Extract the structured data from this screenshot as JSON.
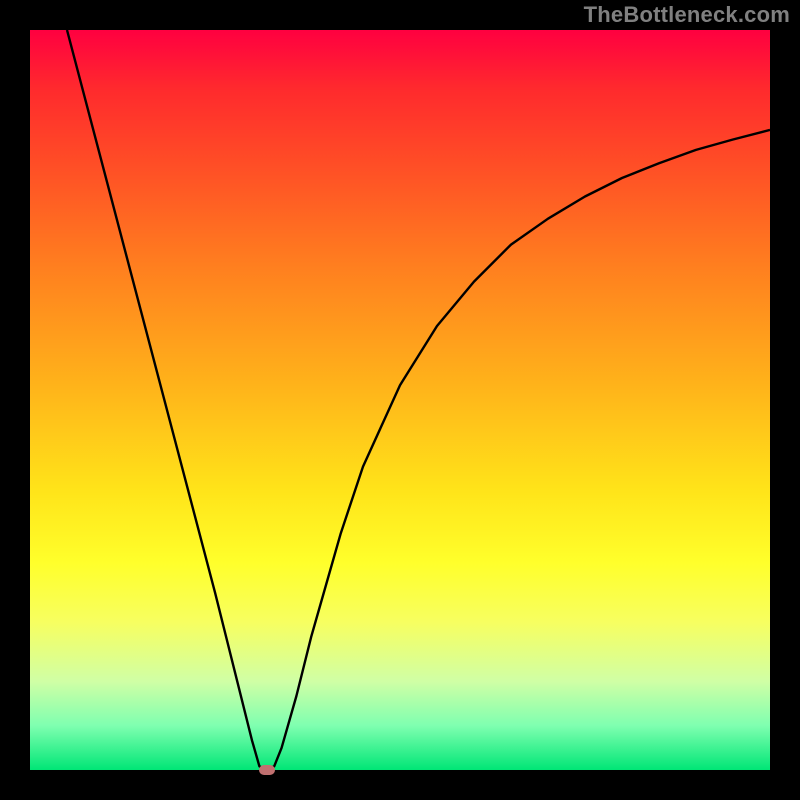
{
  "watermark": "TheBottleneck.com",
  "chart_data": {
    "type": "line",
    "title": "",
    "xlabel": "",
    "ylabel": "",
    "xlim": [
      0,
      100
    ],
    "ylim": [
      0,
      100
    ],
    "grid": false,
    "legend": false,
    "series": [
      {
        "name": "curve",
        "x": [
          5,
          10,
          15,
          20,
          25,
          28,
          30,
          31,
          32,
          33,
          34,
          36,
          38,
          40,
          42,
          45,
          50,
          55,
          60,
          65,
          70,
          75,
          80,
          85,
          90,
          95,
          100
        ],
        "y": [
          100,
          81,
          62,
          43,
          24,
          12,
          4,
          0.5,
          0,
          0.5,
          3,
          10,
          18,
          25,
          32,
          41,
          52,
          60,
          66,
          71,
          74.5,
          77.5,
          80,
          82,
          83.8,
          85.2,
          86.5
        ]
      }
    ],
    "marker": {
      "x": 32,
      "y": 0,
      "shape": "pill",
      "color": "#c07070"
    },
    "background_gradient": {
      "stops": [
        {
          "pos": 0,
          "color": "#ff0040"
        },
        {
          "pos": 8,
          "color": "#ff2a2d"
        },
        {
          "pos": 18,
          "color": "#ff4d26"
        },
        {
          "pos": 32,
          "color": "#ff7f1f"
        },
        {
          "pos": 48,
          "color": "#ffb31a"
        },
        {
          "pos": 62,
          "color": "#ffe319"
        },
        {
          "pos": 72,
          "color": "#ffff2b"
        },
        {
          "pos": 80,
          "color": "#f7ff60"
        },
        {
          "pos": 88,
          "color": "#d0ffa5"
        },
        {
          "pos": 94,
          "color": "#7fffb0"
        },
        {
          "pos": 100,
          "color": "#00e676"
        }
      ]
    }
  }
}
